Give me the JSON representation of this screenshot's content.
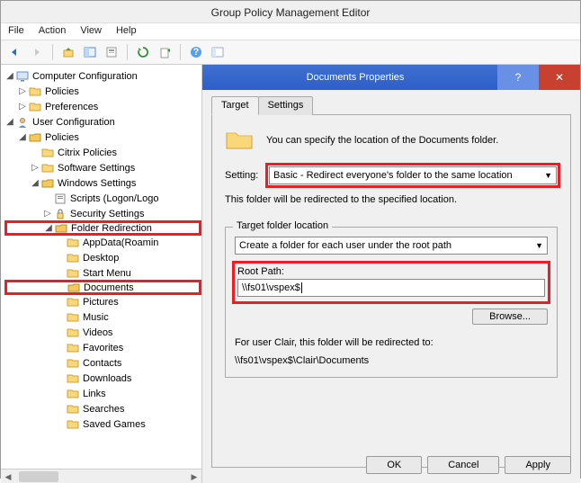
{
  "window_title": "Group Policy Management Editor",
  "menu": {
    "file": "File",
    "action": "Action",
    "view": "View",
    "help": "Help"
  },
  "tree": {
    "root_cc": "Computer Configuration",
    "cc_policies": "Policies",
    "cc_prefs": "Preferences",
    "root_uc": "User Configuration",
    "uc_policies": "Policies",
    "citrix": "Citrix Policies",
    "swset": "Software Settings",
    "winset": "Windows Settings",
    "scripts": "Scripts (Logon/Logo",
    "secset": "Security Settings",
    "folderredir": "Folder Redirection",
    "appdata": "AppData(Roamin",
    "desktop": "Desktop",
    "startmenu": "Start Menu",
    "documents": "Documents",
    "pictures": "Pictures",
    "music": "Music",
    "videos": "Videos",
    "favorites": "Favorites",
    "contacts": "Contacts",
    "downloads": "Downloads",
    "links": "Links",
    "searches": "Searches",
    "savedgames": "Saved Games"
  },
  "dialog": {
    "title": "Documents Properties",
    "tab_target": "Target",
    "tab_settings": "Settings",
    "desc": "You can specify the location of the Documents folder.",
    "setting_label": "Setting:",
    "setting_value": "Basic - Redirect everyone's folder to the same location",
    "redirect_note": "This folder will be redirected to the specified location.",
    "fieldset_legend": "Target folder location",
    "target_combo": "Create a folder for each user under the root path",
    "root_path_label": "Root Path:",
    "root_path_value": "\\\\fs01\\vspex$",
    "browse": "Browse...",
    "example_header": "For user Clair, this folder will be redirected to:",
    "example_path": "\\\\fs01\\vspex$\\Clair\\Documents",
    "ok": "OK",
    "cancel": "Cancel",
    "apply": "Apply"
  }
}
